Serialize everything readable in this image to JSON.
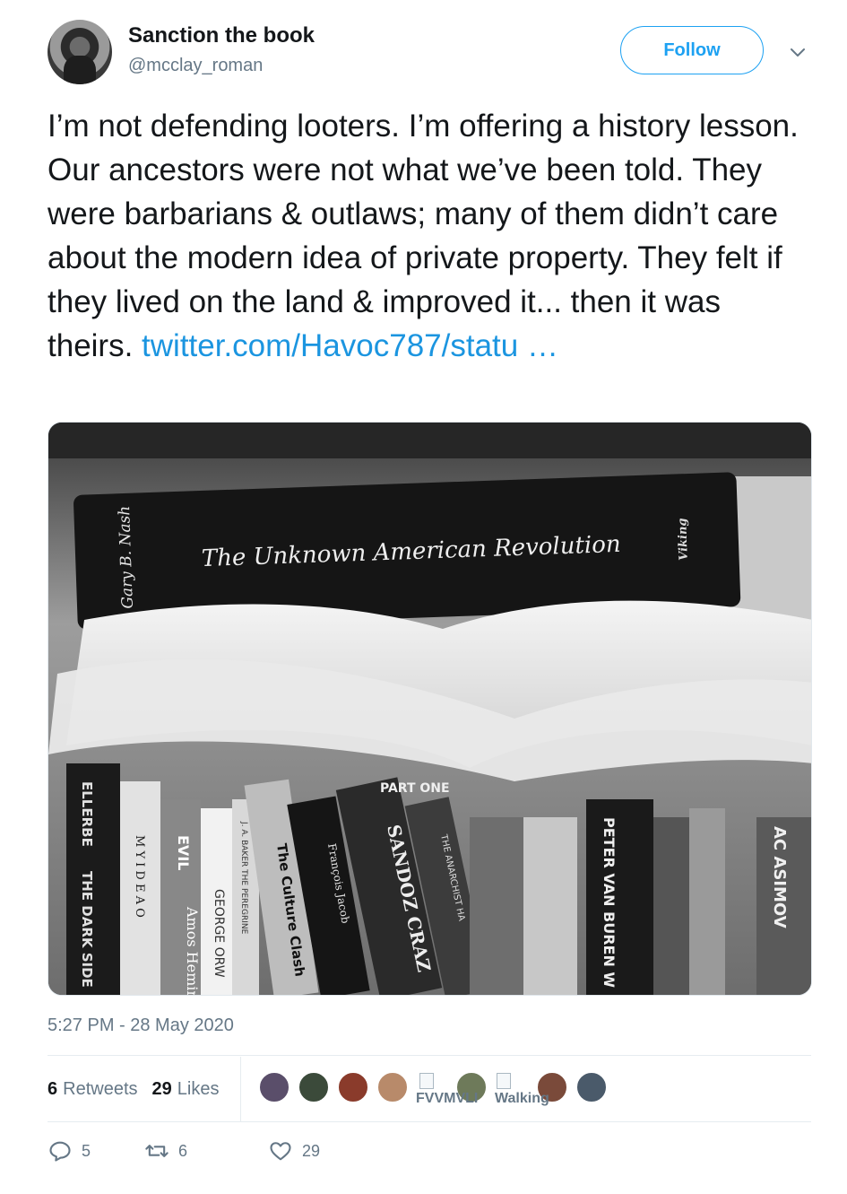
{
  "author": {
    "name": "Sanction the book",
    "handle": "@mcclay_roman",
    "follow_label": "Follow"
  },
  "tweet": {
    "text": "I’m not defending looters. I’m offering a history lesson. Our ancestors were not what we’ve been told. They were barbarians & outlaws; many of them didn’t care about the modern idea of private property. They felt if they lived on the land & improved it... then it was theirs.",
    "link": "twitter.com/Havoc787/statu …",
    "timestamp": "5:27 PM - 28 May 2020"
  },
  "media": {
    "book_top": {
      "author": "Gary B. Nash",
      "title": "The Unknown American Revolution",
      "publisher": "Viking"
    },
    "spines": [
      "ELLERBE",
      "THE DARK SIDE",
      "M Y   I D E A   O",
      "EVIL",
      "Amos Hemin",
      "GEORGE ORW",
      "J. A. BAKER   THE PEREGRINE",
      "The Culture Clash",
      "François Jacob",
      "SANDOZ  CRAZ",
      "THE ANARCHIST HA",
      "PART ONE",
      "PETER VAN BUREN  W",
      "AC ASIMOV"
    ]
  },
  "stats": {
    "retweets_count": "6",
    "retweets_label": "Retweets",
    "likes_count": "29",
    "likes_label": "Likes"
  },
  "likers": {
    "labels": [
      "FVVMVLI",
      "Walking"
    ]
  },
  "actions": {
    "reply_count": "5",
    "retweet_count": "6",
    "like_count": "29"
  },
  "colors": {
    "accent": "#1da1f2",
    "link": "#1b95e0",
    "muted": "#657786",
    "text": "#14171a"
  }
}
